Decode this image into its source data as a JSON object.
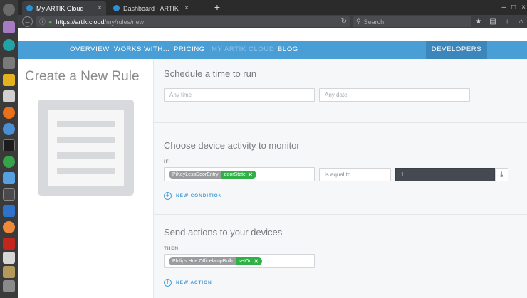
{
  "browser": {
    "tabs": [
      {
        "label": "My ARTIK Cloud",
        "close": "×"
      },
      {
        "label": "Dashboard - ARTIK ...",
        "close": "×"
      }
    ],
    "new_tab": "+",
    "window_controls": [
      "–",
      "□",
      "×"
    ],
    "url_host": "https://artik.cloud",
    "url_path": "/my/rules/new",
    "search_placeholder": "Search",
    "nav_icons": [
      "bookmark-star-icon",
      "library-icon",
      "download-icon",
      "home-icon",
      "menu-icon"
    ]
  },
  "site_nav": {
    "items": [
      "OVERVIEW",
      "WORKS WITH...",
      "PRICING",
      "MY ARTIK CLOUD",
      "BLOG"
    ],
    "active": "MY ARTIK CLOUD",
    "developers": "DEVELOPERS"
  },
  "page": {
    "title": "Create a New Rule"
  },
  "schedule": {
    "title": "Schedule a time to run",
    "time_placeholder": "Any time",
    "date_placeholder": "Any date"
  },
  "condition": {
    "title": "Choose device activity to monitor",
    "kicker": "IF",
    "device": "PiKeyLessDoorEntry",
    "field": "doorState",
    "operator": "is equal to",
    "value": "1",
    "add_label": "NEW CONDITION"
  },
  "action": {
    "title": "Send actions to your devices",
    "kicker": "THEN",
    "device": "Philips Hue OfficelampBulb",
    "action": "setOn",
    "add_label": "NEW ACTION"
  },
  "colors": {
    "brand_blue": "#4a9ed6",
    "chip_green": "#2fb148",
    "dark_value": "#454a52"
  }
}
